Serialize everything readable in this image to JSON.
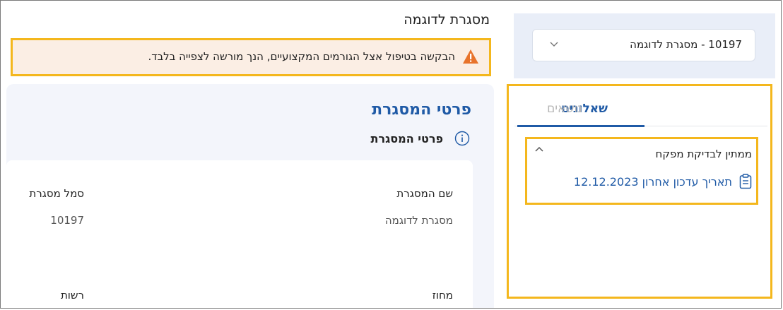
{
  "page": {
    "title": "מסגרת לדוגמה"
  },
  "alert": {
    "text": "הבקשה בטיפול אצל הגורמים המקצועיים, הנך מורשה לצפייה בלבד."
  },
  "selector": {
    "value": "10197 - מסגרת לדוגמה"
  },
  "tabs": [
    {
      "label": "שאלונים",
      "active": true
    },
    {
      "label": "נושאים",
      "active": false
    }
  ],
  "group": {
    "title": "ממתין לבדיקת מפקח",
    "item_label": "תאריך עדכון אחרון 12.12.2023"
  },
  "card": {
    "title": "פרטי המסגרת",
    "section_title": "פרטי המסגרת",
    "fields": [
      {
        "label": "שם המסגרת",
        "value": "מסגרת לדוגמה"
      },
      {
        "label": "סמל מסגרת",
        "value": "10197"
      },
      {
        "label": "מחוז",
        "value": ""
      },
      {
        "label": "רשות",
        "value": ""
      }
    ]
  },
  "colors": {
    "accent": "#1f5aa6",
    "highlight_border": "#f4b71d",
    "warning": "#e8732b",
    "alert_bg": "#fbeee4",
    "sidebar_bg": "#e9eef8"
  }
}
